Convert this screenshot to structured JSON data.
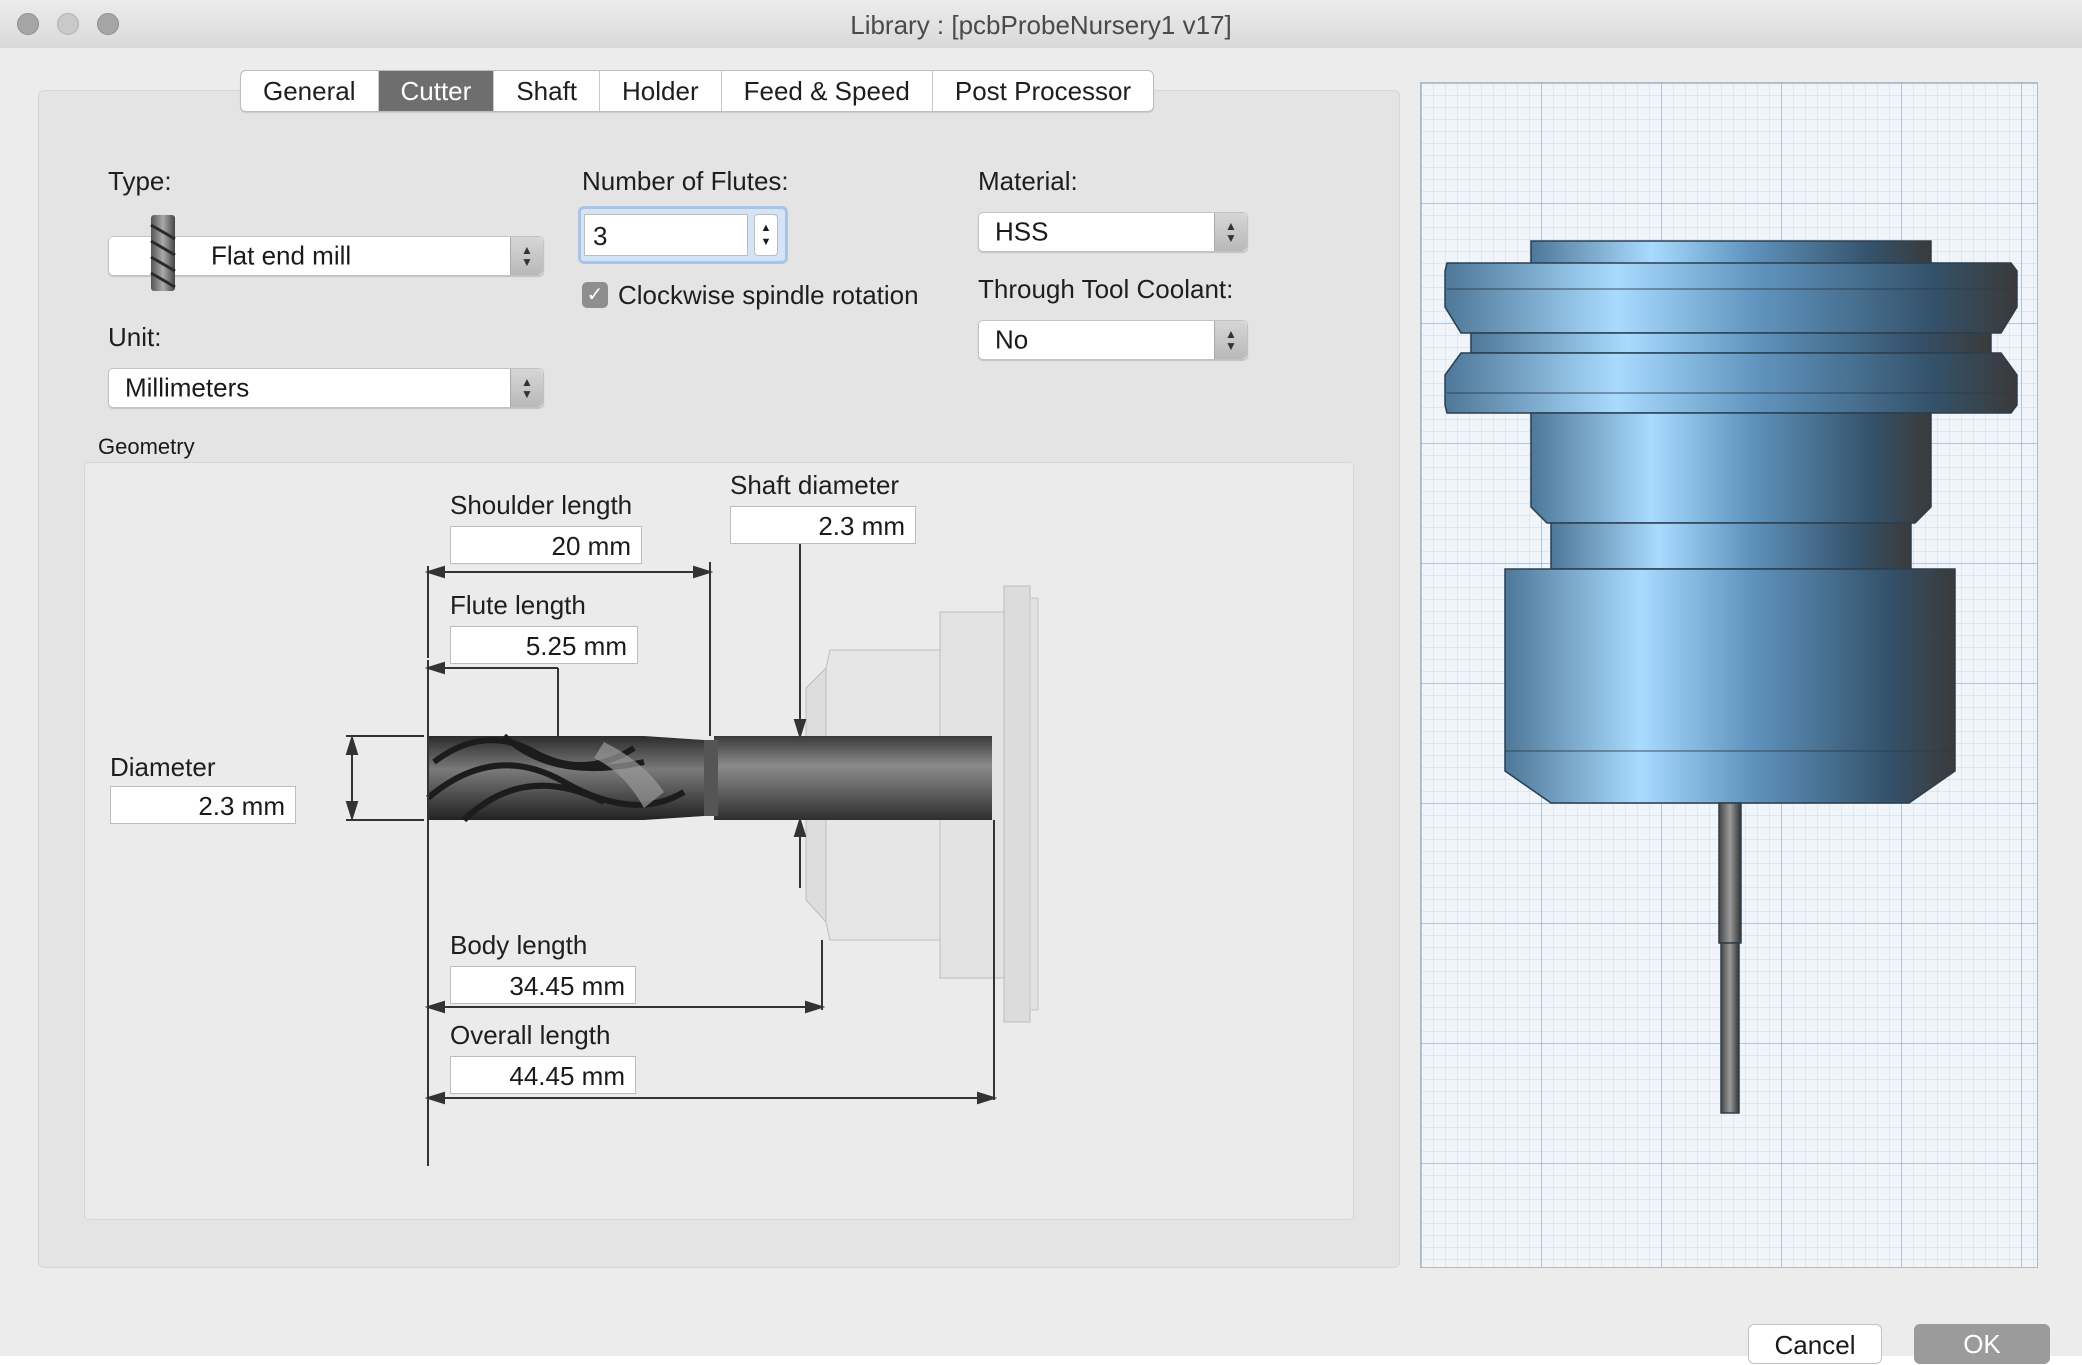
{
  "window": {
    "title": "Library : [pcbProbeNursery1 v17]"
  },
  "tabs": [
    {
      "label": "General",
      "active": false
    },
    {
      "label": "Cutter",
      "active": true
    },
    {
      "label": "Shaft",
      "active": false
    },
    {
      "label": "Holder",
      "active": false
    },
    {
      "label": "Feed & Speed",
      "active": false
    },
    {
      "label": "Post Processor",
      "active": false
    }
  ],
  "form": {
    "type_label": "Type:",
    "type_value": "Flat end mill",
    "unit_label": "Unit:",
    "unit_value": "Millimeters",
    "flutes_label": "Number of Flutes:",
    "flutes_value": "3",
    "clockwise_label": "Clockwise spindle rotation",
    "clockwise_checked": true,
    "material_label": "Material:",
    "material_value": "HSS",
    "coolant_label": "Through Tool Coolant:",
    "coolant_value": "No"
  },
  "geometry": {
    "section_label": "Geometry",
    "shoulder_length_label": "Shoulder length",
    "shoulder_length_value": "20 mm",
    "shaft_diameter_label": "Shaft diameter",
    "shaft_diameter_value": "2.3 mm",
    "flute_length_label": "Flute length",
    "flute_length_value": "5.25 mm",
    "diameter_label": "Diameter",
    "diameter_value": "2.3 mm",
    "body_length_label": "Body length",
    "body_length_value": "34.45 mm",
    "overall_length_label": "Overall length",
    "overall_length_value": "44.45 mm"
  },
  "buttons": {
    "cancel": "Cancel",
    "ok": "OK"
  },
  "colors": {
    "tab_active": "#6e6e6e",
    "holder_blue": "#5b8fb8",
    "ok_disabled": "#9b9b9b"
  }
}
